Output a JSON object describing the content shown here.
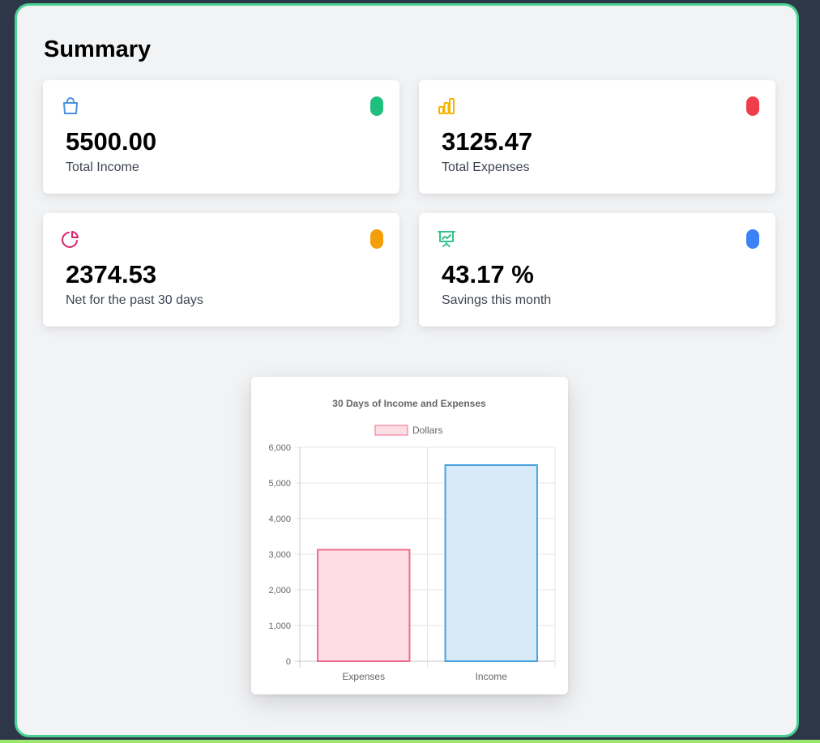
{
  "page": {
    "title": "Summary"
  },
  "cards": [
    {
      "value": "5500.00",
      "label": "Total Income",
      "icon": "shopping-bag-icon",
      "icon_color": "#4a90e2",
      "dot_color": "#1fbf7f"
    },
    {
      "value": "3125.47",
      "label": "Total Expenses",
      "icon": "bar-chart-icon",
      "icon_color": "#f4b400",
      "dot_color": "#ef3e4a"
    },
    {
      "value": "2374.53",
      "label": "Net for the past 30 days",
      "icon": "pie-chart-icon",
      "icon_color": "#d6246e",
      "dot_color": "#f59e0b"
    },
    {
      "value": "43.17 %",
      "label": "Savings this month",
      "icon": "presentation-chart-icon",
      "icon_color": "#36c28b",
      "dot_color": "#3b82f6"
    }
  ],
  "chart_data": {
    "type": "bar",
    "title": "30 Days of Income and Expenses",
    "categories": [
      "Expenses",
      "Income"
    ],
    "series": [
      {
        "name": "Dollars",
        "values": [
          3125.47,
          5500.0
        ]
      }
    ],
    "bar_fill_colors": [
      "#ffdde4",
      "#d8eaf8"
    ],
    "bar_border_colors": [
      "#ef6d8f",
      "#4aa3df"
    ],
    "ylim": [
      0,
      6000
    ],
    "yticks": [
      "0",
      "1,000",
      "2,000",
      "3,000",
      "4,000",
      "5,000",
      "6,000"
    ],
    "tick_values": [
      0,
      1000,
      2000,
      3000,
      4000,
      5000,
      6000
    ],
    "grid": true,
    "legend_position": "top"
  }
}
